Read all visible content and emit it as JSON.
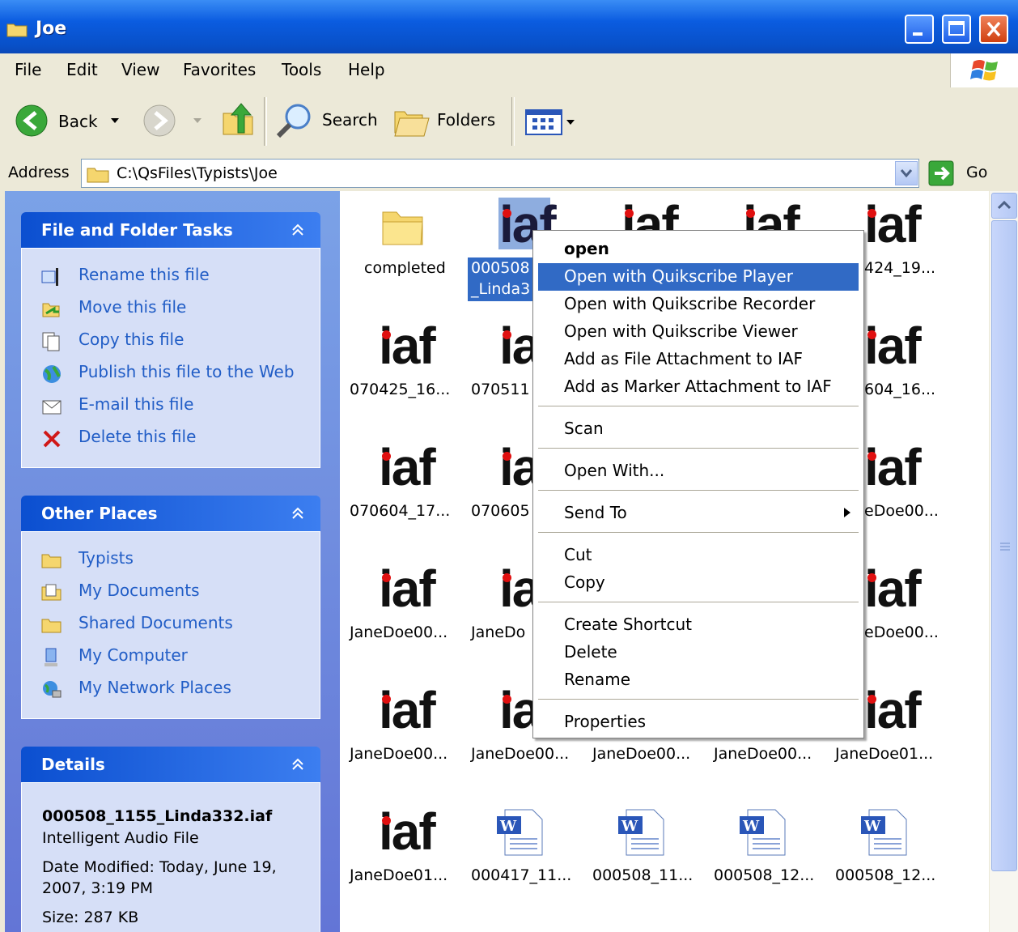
{
  "window": {
    "title": "Joe"
  },
  "menubar": {
    "items": [
      "File",
      "Edit",
      "View",
      "Favorites",
      "Tools",
      "Help"
    ]
  },
  "toolbar": {
    "back_label": "Back",
    "search_label": "Search",
    "folders_label": "Folders"
  },
  "address": {
    "label": "Address",
    "value": "C:\\QsFiles\\Typists\\Joe",
    "go_label": "Go"
  },
  "sidebar": {
    "file_tasks": {
      "title": "File and Folder Tasks",
      "items": [
        "Rename this file",
        "Move this file",
        "Copy this file",
        "Publish this file to the Web",
        "E-mail this file",
        "Delete this file"
      ]
    },
    "other_places": {
      "title": "Other Places",
      "items": [
        "Typists",
        "My Documents",
        "Shared Documents",
        "My Computer",
        "My Network Places"
      ]
    },
    "details": {
      "title": "Details",
      "filename": "000508_1155_Linda332.iaf",
      "filetype": "Intelligent Audio File",
      "modified_line1": "Date Modified: Today, June 19,",
      "modified_line2": "2007, 3:19 PM",
      "size": "Size: 287 KB"
    }
  },
  "files": {
    "iaf_glyph": "iaf",
    "row1": [
      "completed",
      "000508",
      "_Linda3",
      "424_19..."
    ],
    "row2": [
      "070425_16...",
      "070511",
      "604_16..."
    ],
    "row3": [
      "070604_17...",
      "070605",
      "eDoe00..."
    ],
    "row4": [
      "JaneDoe00...",
      "JaneDo",
      "eDoe00..."
    ],
    "row5": [
      "JaneDoe00...",
      "JaneDoe00...",
      "JaneDoe00...",
      "JaneDoe00...",
      "JaneDoe01..."
    ],
    "row6": [
      "JaneDoe01...",
      "000417_11...",
      "000508_11...",
      "000508_12...",
      "000508_12..."
    ]
  },
  "context_menu": {
    "items": [
      "open",
      "Open with Quikscribe Player",
      "Open with Quikscribe Recorder",
      "Open with Quikscribe Viewer",
      "Add as File Attachment to IAF",
      "Add as Marker Attachment to IAF",
      "Scan",
      "Open With...",
      "Send To",
      "Cut",
      "Copy",
      "Create Shortcut",
      "Delete",
      "Rename",
      "Properties"
    ],
    "highlighted": "Open with Quikscribe Player"
  },
  "colors": {
    "title_blue": "#0b5ce0",
    "highlight": "#316ac5",
    "task_link": "#215dc6",
    "iaf_dot": "#e01010"
  }
}
